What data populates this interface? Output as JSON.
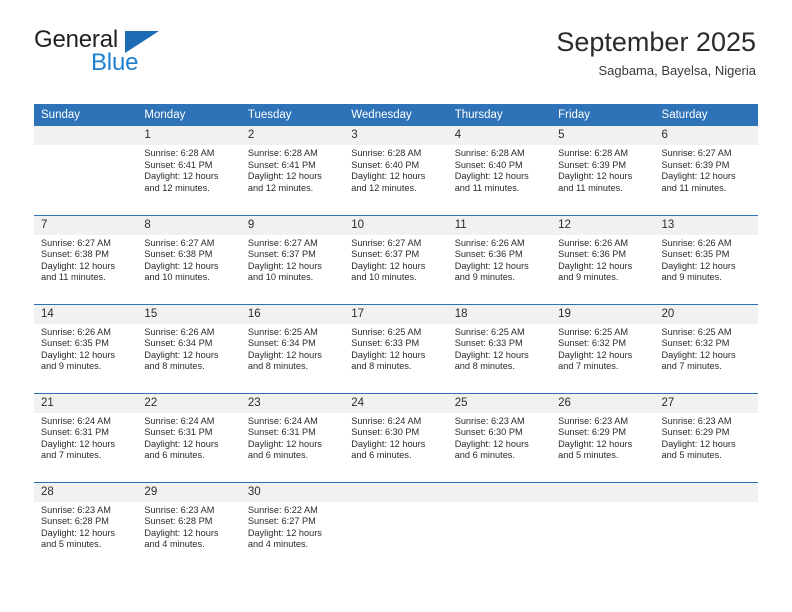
{
  "brand": {
    "name_top": "General",
    "name_bottom": "Blue"
  },
  "header": {
    "title": "September 2025",
    "subtitle": "Sagbama, Bayelsa, Nigeria"
  },
  "colors": {
    "header_blue": "#2e72b8",
    "daynum_background": "#f1f1ef",
    "brand_blue": "#2080d0",
    "text": "#2b2b2b"
  },
  "weekdays": [
    "Sunday",
    "Monday",
    "Tuesday",
    "Wednesday",
    "Thursday",
    "Friday",
    "Saturday"
  ],
  "weeks": [
    [
      {
        "day": "",
        "sunrise": "",
        "sunset": "",
        "daylight": ""
      },
      {
        "day": "1",
        "sunrise": "Sunrise: 6:28 AM",
        "sunset": "Sunset: 6:41 PM",
        "daylight": "Daylight: 12 hours and 12 minutes."
      },
      {
        "day": "2",
        "sunrise": "Sunrise: 6:28 AM",
        "sunset": "Sunset: 6:41 PM",
        "daylight": "Daylight: 12 hours and 12 minutes."
      },
      {
        "day": "3",
        "sunrise": "Sunrise: 6:28 AM",
        "sunset": "Sunset: 6:40 PM",
        "daylight": "Daylight: 12 hours and 12 minutes."
      },
      {
        "day": "4",
        "sunrise": "Sunrise: 6:28 AM",
        "sunset": "Sunset: 6:40 PM",
        "daylight": "Daylight: 12 hours and 11 minutes."
      },
      {
        "day": "5",
        "sunrise": "Sunrise: 6:28 AM",
        "sunset": "Sunset: 6:39 PM",
        "daylight": "Daylight: 12 hours and 11 minutes."
      },
      {
        "day": "6",
        "sunrise": "Sunrise: 6:27 AM",
        "sunset": "Sunset: 6:39 PM",
        "daylight": "Daylight: 12 hours and 11 minutes."
      }
    ],
    [
      {
        "day": "7",
        "sunrise": "Sunrise: 6:27 AM",
        "sunset": "Sunset: 6:38 PM",
        "daylight": "Daylight: 12 hours and 11 minutes."
      },
      {
        "day": "8",
        "sunrise": "Sunrise: 6:27 AM",
        "sunset": "Sunset: 6:38 PM",
        "daylight": "Daylight: 12 hours and 10 minutes."
      },
      {
        "day": "9",
        "sunrise": "Sunrise: 6:27 AM",
        "sunset": "Sunset: 6:37 PM",
        "daylight": "Daylight: 12 hours and 10 minutes."
      },
      {
        "day": "10",
        "sunrise": "Sunrise: 6:27 AM",
        "sunset": "Sunset: 6:37 PM",
        "daylight": "Daylight: 12 hours and 10 minutes."
      },
      {
        "day": "11",
        "sunrise": "Sunrise: 6:26 AM",
        "sunset": "Sunset: 6:36 PM",
        "daylight": "Daylight: 12 hours and 9 minutes."
      },
      {
        "day": "12",
        "sunrise": "Sunrise: 6:26 AM",
        "sunset": "Sunset: 6:36 PM",
        "daylight": "Daylight: 12 hours and 9 minutes."
      },
      {
        "day": "13",
        "sunrise": "Sunrise: 6:26 AM",
        "sunset": "Sunset: 6:35 PM",
        "daylight": "Daylight: 12 hours and 9 minutes."
      }
    ],
    [
      {
        "day": "14",
        "sunrise": "Sunrise: 6:26 AM",
        "sunset": "Sunset: 6:35 PM",
        "daylight": "Daylight: 12 hours and 9 minutes."
      },
      {
        "day": "15",
        "sunrise": "Sunrise: 6:26 AM",
        "sunset": "Sunset: 6:34 PM",
        "daylight": "Daylight: 12 hours and 8 minutes."
      },
      {
        "day": "16",
        "sunrise": "Sunrise: 6:25 AM",
        "sunset": "Sunset: 6:34 PM",
        "daylight": "Daylight: 12 hours and 8 minutes."
      },
      {
        "day": "17",
        "sunrise": "Sunrise: 6:25 AM",
        "sunset": "Sunset: 6:33 PM",
        "daylight": "Daylight: 12 hours and 8 minutes."
      },
      {
        "day": "18",
        "sunrise": "Sunrise: 6:25 AM",
        "sunset": "Sunset: 6:33 PM",
        "daylight": "Daylight: 12 hours and 8 minutes."
      },
      {
        "day": "19",
        "sunrise": "Sunrise: 6:25 AM",
        "sunset": "Sunset: 6:32 PM",
        "daylight": "Daylight: 12 hours and 7 minutes."
      },
      {
        "day": "20",
        "sunrise": "Sunrise: 6:25 AM",
        "sunset": "Sunset: 6:32 PM",
        "daylight": "Daylight: 12 hours and 7 minutes."
      }
    ],
    [
      {
        "day": "21",
        "sunrise": "Sunrise: 6:24 AM",
        "sunset": "Sunset: 6:31 PM",
        "daylight": "Daylight: 12 hours and 7 minutes."
      },
      {
        "day": "22",
        "sunrise": "Sunrise: 6:24 AM",
        "sunset": "Sunset: 6:31 PM",
        "daylight": "Daylight: 12 hours and 6 minutes."
      },
      {
        "day": "23",
        "sunrise": "Sunrise: 6:24 AM",
        "sunset": "Sunset: 6:31 PM",
        "daylight": "Daylight: 12 hours and 6 minutes."
      },
      {
        "day": "24",
        "sunrise": "Sunrise: 6:24 AM",
        "sunset": "Sunset: 6:30 PM",
        "daylight": "Daylight: 12 hours and 6 minutes."
      },
      {
        "day": "25",
        "sunrise": "Sunrise: 6:23 AM",
        "sunset": "Sunset: 6:30 PM",
        "daylight": "Daylight: 12 hours and 6 minutes."
      },
      {
        "day": "26",
        "sunrise": "Sunrise: 6:23 AM",
        "sunset": "Sunset: 6:29 PM",
        "daylight": "Daylight: 12 hours and 5 minutes."
      },
      {
        "day": "27",
        "sunrise": "Sunrise: 6:23 AM",
        "sunset": "Sunset: 6:29 PM",
        "daylight": "Daylight: 12 hours and 5 minutes."
      }
    ],
    [
      {
        "day": "28",
        "sunrise": "Sunrise: 6:23 AM",
        "sunset": "Sunset: 6:28 PM",
        "daylight": "Daylight: 12 hours and 5 minutes."
      },
      {
        "day": "29",
        "sunrise": "Sunrise: 6:23 AM",
        "sunset": "Sunset: 6:28 PM",
        "daylight": "Daylight: 12 hours and 4 minutes."
      },
      {
        "day": "30",
        "sunrise": "Sunrise: 6:22 AM",
        "sunset": "Sunset: 6:27 PM",
        "daylight": "Daylight: 12 hours and 4 minutes."
      },
      {
        "day": "",
        "sunrise": "",
        "sunset": "",
        "daylight": ""
      },
      {
        "day": "",
        "sunrise": "",
        "sunset": "",
        "daylight": ""
      },
      {
        "day": "",
        "sunrise": "",
        "sunset": "",
        "daylight": ""
      },
      {
        "day": "",
        "sunrise": "",
        "sunset": "",
        "daylight": ""
      }
    ]
  ]
}
